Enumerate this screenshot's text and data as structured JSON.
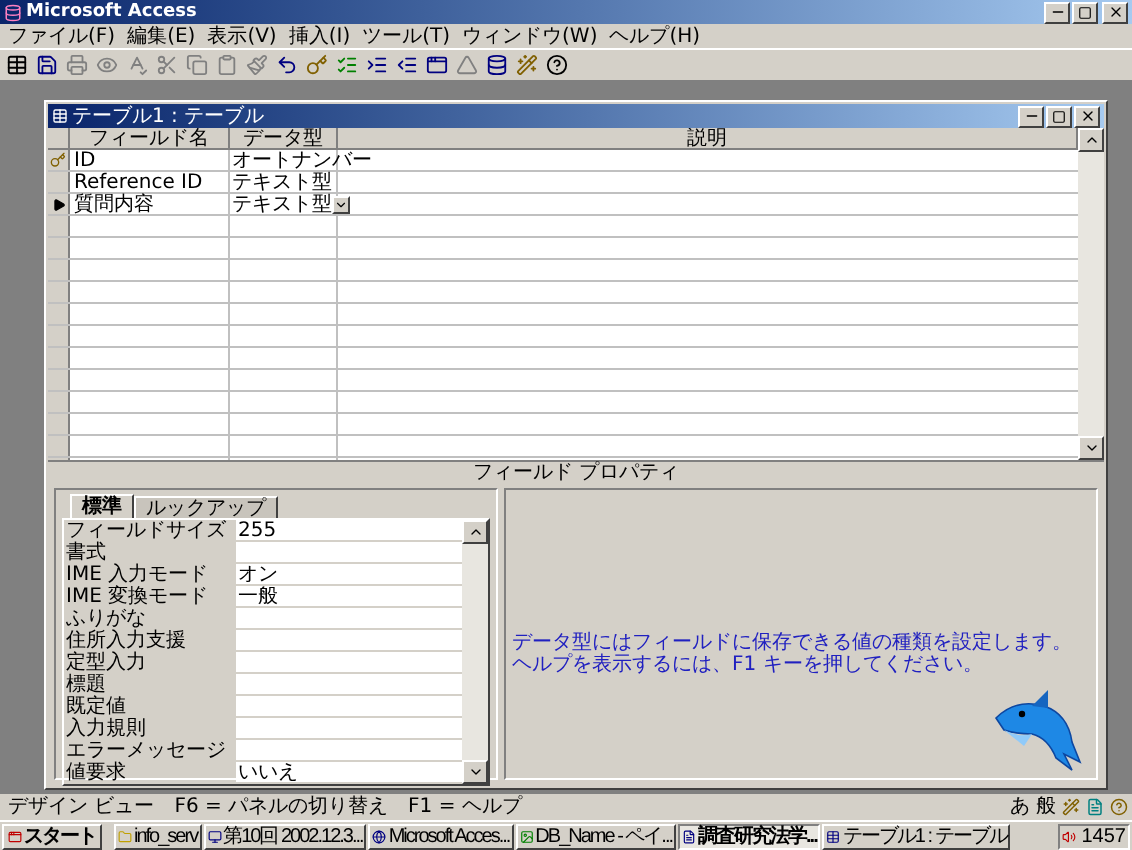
{
  "app_title": "Microsoft Access",
  "menu": [
    "ファイル(F)",
    "編集(E)",
    "表示(V)",
    "挿入(I)",
    "ツール(T)",
    "ウィンドウ(W)",
    "ヘルプ(H)"
  ],
  "window": {
    "title": "テーブル1 : テーブル"
  },
  "grid": {
    "columns": [
      "フィールド名",
      "データ型",
      "説明"
    ],
    "rows": [
      {
        "field_name": "ID",
        "data_type": "オートナンバー",
        "primary_key": true,
        "selected": false
      },
      {
        "field_name": "Reference ID",
        "data_type": "テキスト型",
        "primary_key": false,
        "selected": false
      },
      {
        "field_name": "質問内容",
        "data_type": "テキスト型",
        "primary_key": false,
        "selected": true
      }
    ]
  },
  "properties_label": "フィールド プロパティ",
  "property_tabs": [
    {
      "label": "標準",
      "selected": true
    },
    {
      "label": "ルックアップ",
      "selected": false
    }
  ],
  "properties": [
    {
      "name": "フィールドサイズ",
      "value": "255"
    },
    {
      "name": "書式"
    },
    {
      "name": "IME 入力モード",
      "value": "オン"
    },
    {
      "name": "IME 変換モード",
      "value": "一般"
    },
    {
      "name": "ふりがな"
    },
    {
      "name": "住所入力支援"
    },
    {
      "name": "定型入力"
    },
    {
      "name": "標題"
    },
    {
      "name": "既定値"
    },
    {
      "name": "入力規則"
    },
    {
      "name": "エラーメッセージ"
    },
    {
      "name": "値要求",
      "value": "いいえ"
    }
  ],
  "help_text": "データ型にはフィールドに保存できる値の種類を設定します。ヘルプを表示するには、F1 キーを押してください。",
  "status_bar": {
    "texts": [
      "デザイン ビュー",
      "F6 = パネルの切り替え",
      "F1 = ヘルプ"
    ],
    "ime": [
      "あ",
      "般"
    ]
  },
  "taskbar": {
    "start": "スタート",
    "items": [
      {
        "label": "info_serv",
        "selected": false
      },
      {
        "label": "第10回 2002.12.3...",
        "selected": false
      },
      {
        "label": "Microsoft Acces...",
        "selected": false
      },
      {
        "label": "DB_Name - ペイ...",
        "selected": false
      },
      {
        "label": "調査研究法学...",
        "selected": true
      },
      {
        "label": "テーブル1 : テーブル",
        "selected": false
      }
    ],
    "clock": "1457"
  }
}
